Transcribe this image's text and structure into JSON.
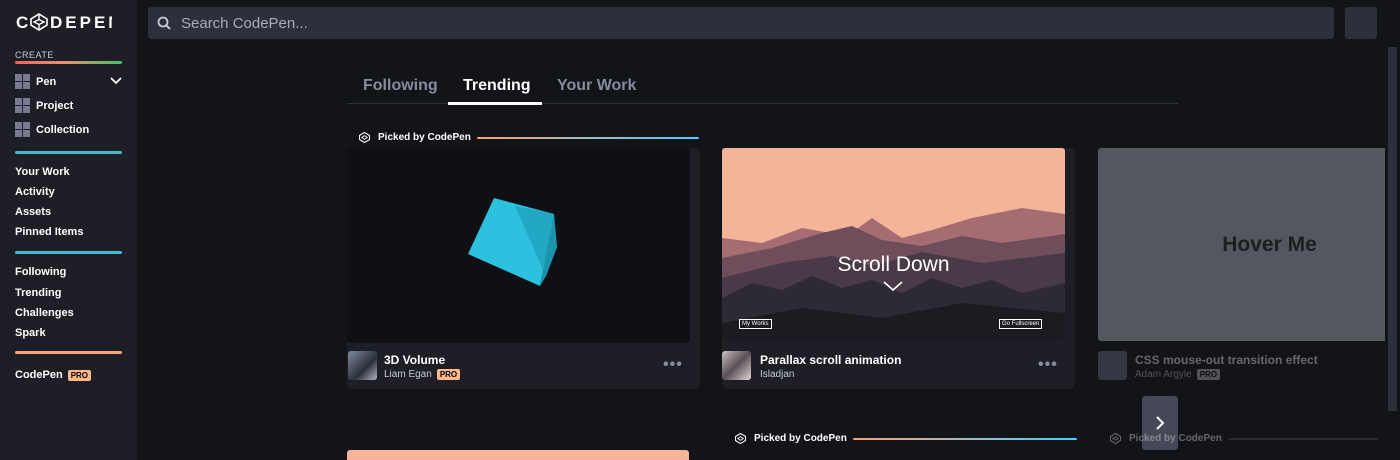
{
  "app": {
    "logo_text": "CODEPEN"
  },
  "sidebar": {
    "create_label": "CREATE",
    "create_items": [
      {
        "label": "Pen",
        "icon": "pen-grid-icon"
      },
      {
        "label": "Project",
        "icon": "project-grid-icon"
      },
      {
        "label": "Collection",
        "icon": "collection-grid-icon"
      }
    ],
    "work_items": [
      "Your Work",
      "Activity",
      "Assets",
      "Pinned Items"
    ],
    "discover_items": [
      "Following",
      "Trending",
      "Challenges",
      "Spark"
    ],
    "pro_item": {
      "label": "CodePen",
      "badge": "PRO"
    }
  },
  "search": {
    "placeholder": "Search CodePen..."
  },
  "tabs": [
    {
      "label": "Following",
      "active": false
    },
    {
      "label": "Trending",
      "active": true
    },
    {
      "label": "Your Work",
      "active": false
    }
  ],
  "picked_label": "Picked by CodePen",
  "cards": [
    {
      "title": "3D Volume",
      "author": "Liam Egan",
      "badge": "PRO",
      "more": "•••"
    },
    {
      "title": "Parallax scroll animation",
      "author": "Isladjan",
      "more": "•••",
      "thumb": {
        "heading": "Scroll Down",
        "btn_left": "My Works",
        "btn_right": "Go Fullscreen"
      }
    },
    {
      "title": "CSS mouse-out transition effect",
      "author": "Adam Argyle",
      "badge": "PRO",
      "thumb": {
        "heading": "Hover Me"
      }
    }
  ],
  "colors": {
    "accent_blue": "#47b8d1",
    "accent_orange": "#ffa47a",
    "cube": "#29bedd",
    "bg": "#131417",
    "panel": "#1e1f26"
  }
}
